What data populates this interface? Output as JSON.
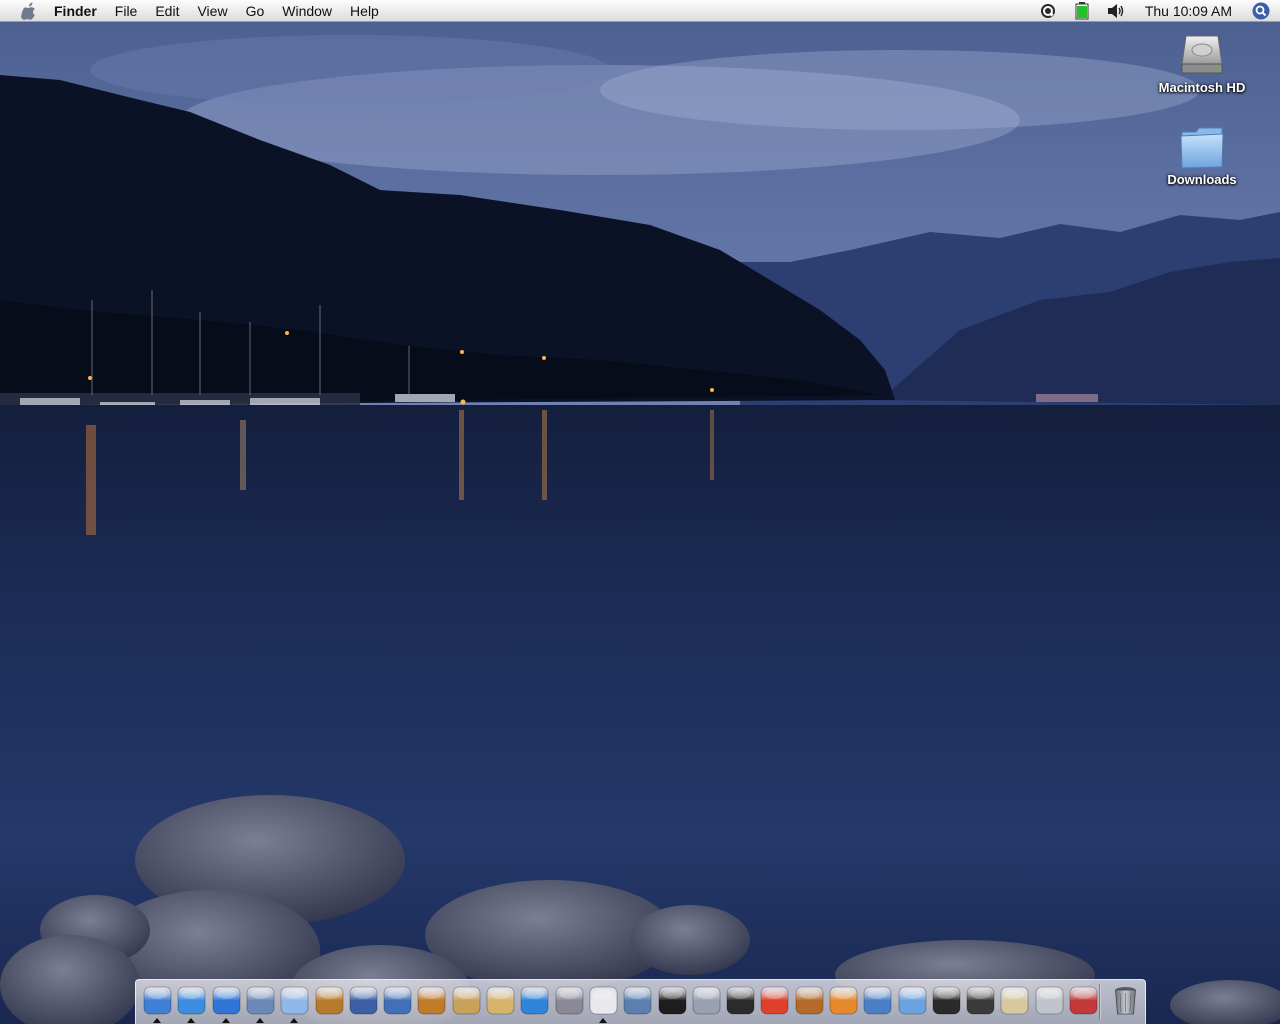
{
  "menubar": {
    "apple_icon": "apple-logo-icon",
    "app_name": "Finder",
    "items": [
      "File",
      "Edit",
      "View",
      "Go",
      "Window",
      "Help"
    ],
    "status_icons": [
      "quicktime-icon",
      "battery-icon",
      "volume-icon"
    ],
    "clock": "Thu 10:09 AM",
    "spotlight_icon": "spotlight-icon"
  },
  "desktop": {
    "icons": [
      {
        "label": "Macintosh HD",
        "icon": "hard-drive-icon"
      },
      {
        "label": "Downloads",
        "icon": "folder-icon"
      }
    ]
  },
  "dock": {
    "items": [
      {
        "name": "finder",
        "color": "#3f7fd6",
        "running": true
      },
      {
        "name": "safari",
        "color": "#3b8de0",
        "running": true
      },
      {
        "name": "ichat",
        "color": "#2f75d8",
        "running": true
      },
      {
        "name": "mail",
        "color": "#6a89b8",
        "running": true
      },
      {
        "name": "itunes",
        "color": "#8fb8e8",
        "running": true
      },
      {
        "name": "iphoto",
        "color": "#b77a2a",
        "running": false
      },
      {
        "name": "imovie",
        "color": "#3c5fa8",
        "running": false
      },
      {
        "name": "idvd",
        "color": "#4270b8",
        "running": false
      },
      {
        "name": "garageband",
        "color": "#c07a28",
        "running": false
      },
      {
        "name": "keynote",
        "color": "#c9a25a",
        "running": false
      },
      {
        "name": "address-book",
        "color": "#d6b56a",
        "running": false
      },
      {
        "name": "quicktime",
        "color": "#2d84d8",
        "running": false
      },
      {
        "name": "xcode",
        "color": "#8a8a96",
        "running": false
      },
      {
        "name": "textedit",
        "color": "#e8e8ee",
        "running": true
      },
      {
        "name": "preview",
        "color": "#5a7fb0",
        "running": false
      },
      {
        "name": "terminal",
        "color": "#1d1d1d",
        "running": false
      },
      {
        "name": "photo-booth",
        "color": "#9aa0b0",
        "running": false
      },
      {
        "name": "dvd-player",
        "color": "#2b2b2b",
        "running": false
      },
      {
        "name": "cyberduck",
        "color": "#e0402a",
        "running": false
      },
      {
        "name": "helm",
        "color": "#b56a2a",
        "running": false
      },
      {
        "name": "transmit",
        "color": "#e6892c",
        "running": false
      },
      {
        "name": "system-monitor",
        "color": "#4a7fc8",
        "running": false
      },
      {
        "name": "fish-app",
        "color": "#6aa3e0",
        "running": false
      },
      {
        "name": "activity-monitor",
        "color": "#2a2a2a",
        "running": false
      },
      {
        "name": "tar-app",
        "color": "#3a3a3a",
        "running": false
      },
      {
        "name": "installer",
        "color": "#d8c8a0",
        "running": false
      },
      {
        "name": "apple-app",
        "color": "#bfc4cc",
        "running": false
      },
      {
        "name": "utility",
        "color": "#c23a3a",
        "running": false
      }
    ],
    "trash_icon": "trash-icon"
  }
}
